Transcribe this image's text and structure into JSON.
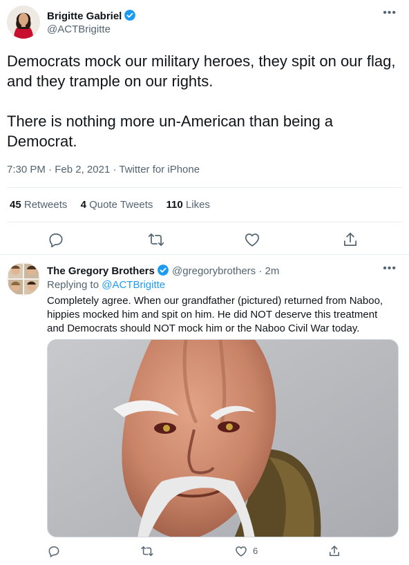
{
  "main_tweet": {
    "author_name": "Brigitte Gabriel",
    "author_handle": "@ACTBrigitte",
    "text_paragraphs": [
      "Democrats mock our military heroes, they spit on our flag, and they trample on our rights.",
      "There is nothing more un-American than being a Democrat."
    ],
    "time": "7:30 PM",
    "date": "Feb 2, 2021",
    "separator": "·",
    "source": "Twitter for iPhone",
    "more_icon": "more-horizontal-icon",
    "stats": {
      "retweets_count": "45",
      "retweets_label": "Retweets",
      "quote_tweets_count": "4",
      "quote_tweets_label": "Quote Tweets",
      "likes_count": "110",
      "likes_label": "Likes"
    },
    "actions": [
      "reply-icon",
      "retweet-icon",
      "like-icon",
      "share-icon"
    ]
  },
  "reply_tweet": {
    "author_name": "The Gregory Brothers",
    "author_handle": "@gregorybrothers",
    "separator": "·",
    "time_ago": "2m",
    "replying_to_label": "Replying to",
    "replying_to_handle": "@ACTBrigitte",
    "text": "Completely agree. When our grandfather (pictured) returned from Naboo, hippies mocked him and spit on him. He did NOT deserve this treatment and Democrats should NOT mock him or the Naboo Civil War today.",
    "like_count": "6",
    "actions": [
      "reply-icon",
      "retweet-icon",
      "like-icon",
      "share-icon"
    ]
  },
  "colors": {
    "accent": "#1d9bf0",
    "secondary_text": "#536471",
    "primary_text": "#0f1419",
    "divider": "#e6ecf0"
  }
}
